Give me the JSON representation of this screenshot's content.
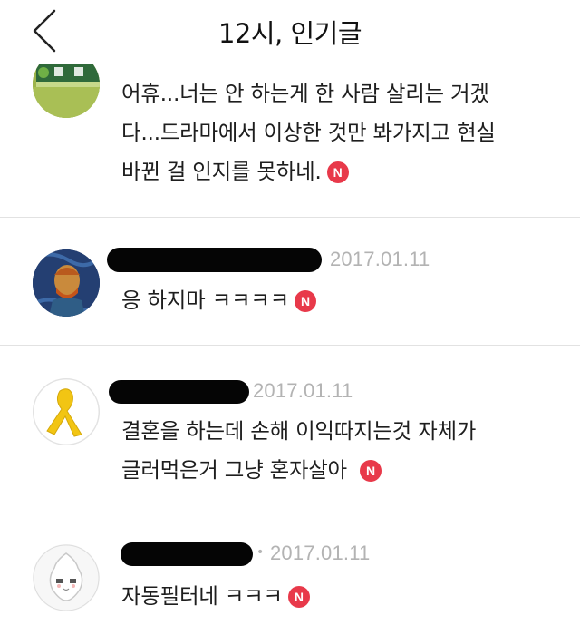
{
  "header": {
    "title": "12시, 인기글"
  },
  "comments": [
    {
      "avatar": "subway-sign-avatar",
      "lines": [
        "어휴...너는 안 하는게 한 사람 살리는 거겠",
        "다...드라마에서 이상한 것만 봐가지고 현실",
        "바뀐 걸 인지를 못하네."
      ],
      "badge": "N"
    },
    {
      "avatar": "van-gogh-avatar",
      "date": "2017.01.11",
      "lines": [
        "응 하지마 ㅋㅋㅋㅋ"
      ],
      "badge": "N"
    },
    {
      "avatar": "yellow-ribbon-avatar",
      "date": "2017.01.11",
      "lines": [
        "결혼을 하는데 손해 이익따지는것 자체가",
        "글러먹은거 그냥 혼자살아"
      ],
      "badge": "N"
    },
    {
      "avatar": "peach-character-avatar",
      "date": "2017.01.11",
      "lines": [
        "자동필터네 ㅋㅋㅋ"
      ],
      "badge": "N"
    }
  ]
}
